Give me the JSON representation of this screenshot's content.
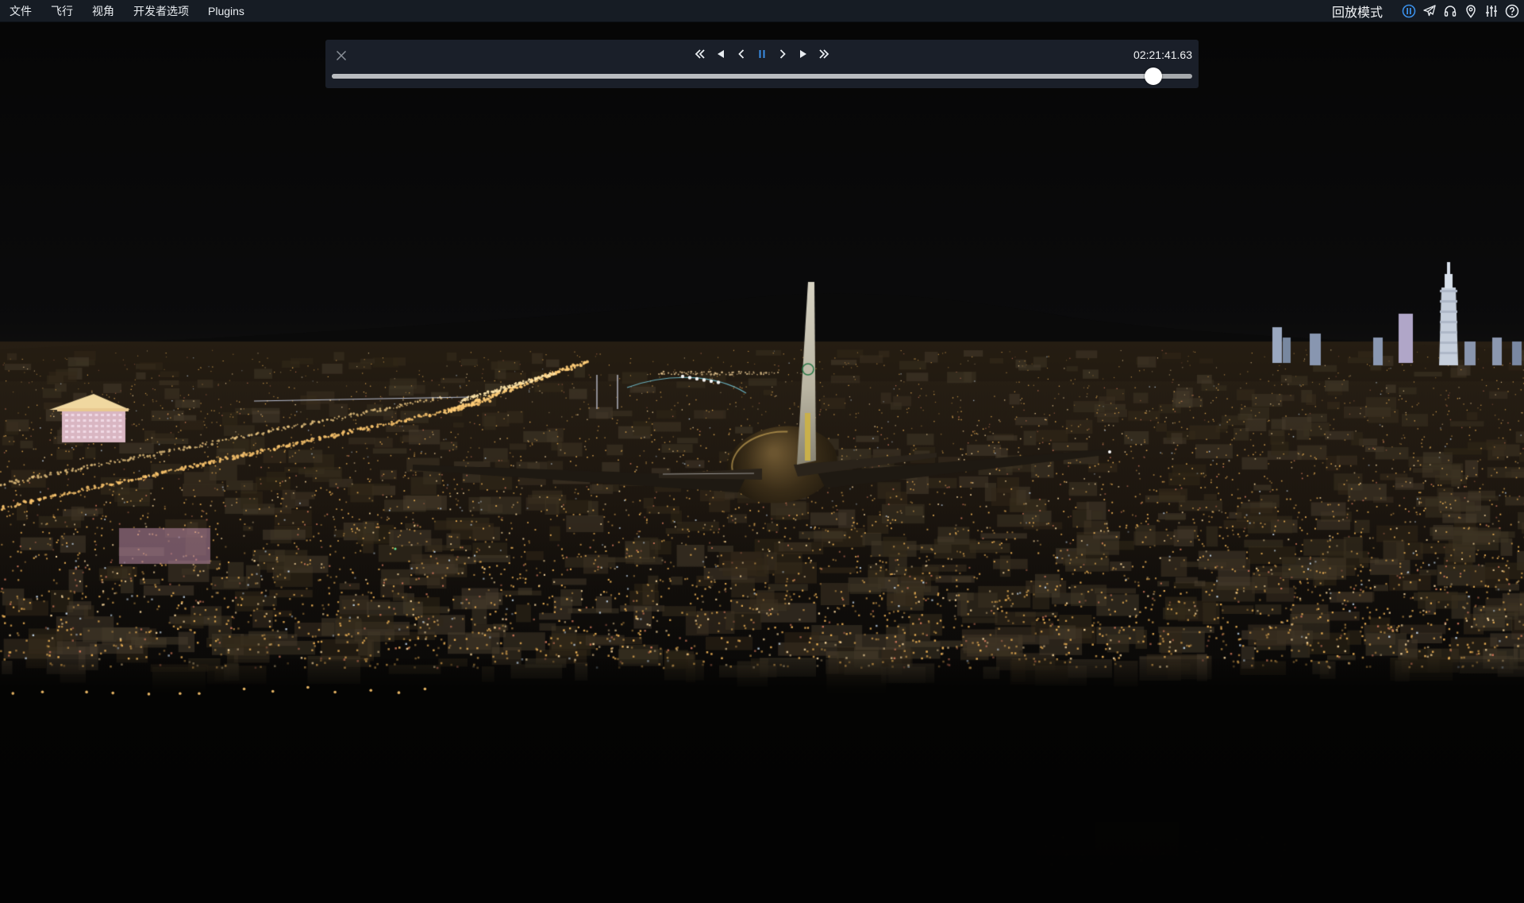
{
  "menubar": {
    "items": [
      {
        "label": "文件"
      },
      {
        "label": "飞行"
      },
      {
        "label": "视角"
      },
      {
        "label": "开发者选项"
      },
      {
        "label": "Plugins"
      }
    ],
    "mode_label": "回放模式",
    "icons": [
      "pause-status-icon",
      "airplane-icon",
      "headset-icon",
      "map-pin-icon",
      "sliders-icon",
      "help-icon"
    ],
    "accent_color": "#3a8fe8"
  },
  "replay": {
    "time": "02:21:41.63",
    "progress": 0.955,
    "controls": [
      "rewind-fast-icon",
      "rewind-icon",
      "step-back-icon",
      "pause-icon",
      "step-forward-icon",
      "play-icon",
      "fast-forward-icon"
    ],
    "active_control": "pause-icon"
  },
  "scene": {
    "description_visible": false,
    "sky_color": "#070707",
    "city_light_color": "#f2b557"
  }
}
